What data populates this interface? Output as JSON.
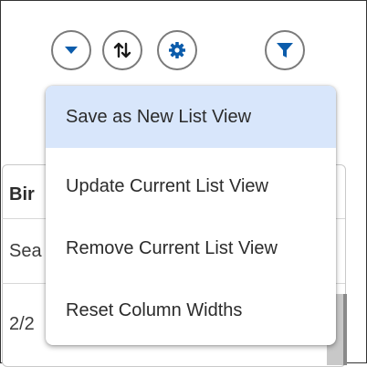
{
  "toolbar": {
    "buttons": [
      {
        "icon": "chevron-down-icon"
      },
      {
        "icon": "sort-arrows-icon"
      },
      {
        "icon": "gear-icon"
      },
      {
        "icon": "filter-icon"
      }
    ]
  },
  "background_list": {
    "header_text": "Bir",
    "search_text": "Sea",
    "row_value": "2/2"
  },
  "menu": {
    "items": [
      {
        "label": "Save as New List View"
      },
      {
        "label": "Update Current List View"
      },
      {
        "label": "Remove Current List View"
      },
      {
        "label": "Reset Column Widths"
      }
    ]
  },
  "colors": {
    "accent": "#0b5cab",
    "selected_bg": "#d8e6fb"
  }
}
